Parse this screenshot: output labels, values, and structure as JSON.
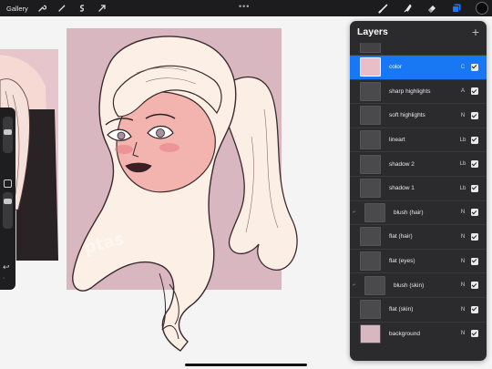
{
  "toolbar": {
    "gallery_label": "Gallery",
    "more_label": "•••",
    "left_tools": [
      "wrench-icon",
      "magic-wand-icon",
      "selection-icon",
      "transform-arrow-icon"
    ],
    "right_tools": [
      "brush-icon",
      "smudge-icon",
      "eraser-icon",
      "layers-icon"
    ],
    "accent_color": "#1877f2",
    "current_color": "#0b0b0b"
  },
  "canvas": {
    "background_color": "#d8b7c0",
    "signature": "ptas"
  },
  "layers_panel": {
    "title": "Layers",
    "add_label": "+",
    "layers": [
      {
        "name": "color",
        "mode": "C",
        "visible": true,
        "selected": true,
        "clipped": false,
        "thumb": "#e9bec7"
      },
      {
        "name": "sharp highlights",
        "mode": "A",
        "visible": true,
        "selected": false,
        "clipped": false,
        "thumb": "#4a4a4c"
      },
      {
        "name": "soft highlights",
        "mode": "N",
        "visible": true,
        "selected": false,
        "clipped": false,
        "thumb": "#4a4a4c"
      },
      {
        "name": "lineart",
        "mode": "Lb",
        "visible": true,
        "selected": false,
        "clipped": false,
        "thumb": "#4a4a4c"
      },
      {
        "name": "shadow 2",
        "mode": "Lb",
        "visible": true,
        "selected": false,
        "clipped": false,
        "thumb": "#4a4a4c"
      },
      {
        "name": "shadow 1",
        "mode": "Lb",
        "visible": true,
        "selected": false,
        "clipped": false,
        "thumb": "#4a4a4c"
      },
      {
        "name": "blush (hair)",
        "mode": "N",
        "visible": true,
        "selected": false,
        "clipped": true,
        "thumb": "#4a4a4c"
      },
      {
        "name": "flat (hair)",
        "mode": "N",
        "visible": true,
        "selected": false,
        "clipped": false,
        "thumb": "#4a4a4c"
      },
      {
        "name": "flat (eyes)",
        "mode": "N",
        "visible": true,
        "selected": false,
        "clipped": false,
        "thumb": "#4a4a4c"
      },
      {
        "name": "blush (skin)",
        "mode": "N",
        "visible": true,
        "selected": false,
        "clipped": true,
        "thumb": "#4a4a4c"
      },
      {
        "name": "flat (skin)",
        "mode": "N",
        "visible": true,
        "selected": false,
        "clipped": false,
        "thumb": "#4a4a4c"
      },
      {
        "name": "background",
        "mode": "N",
        "visible": true,
        "selected": false,
        "clipped": false,
        "thumb": "#d8b7c0"
      }
    ]
  }
}
